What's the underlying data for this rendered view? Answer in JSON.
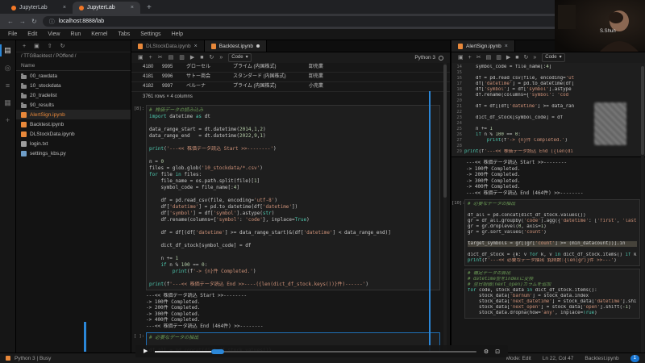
{
  "browser": {
    "tabs": [
      {
        "title": "JupyterLab"
      },
      {
        "title": "JupyterLab"
      }
    ],
    "url": "localhost:8888/lab",
    "nav_icons": [
      {
        "name": "back-icon",
        "glyph": "←"
      },
      {
        "name": "forward-icon",
        "glyph": "→"
      },
      {
        "name": "reload-icon",
        "glyph": "↻"
      }
    ],
    "site_info_glyph": "ⓘ",
    "bookmark_glyph": "☆",
    "overflow_glyph": "⋮"
  },
  "shared": {
    "close_glyph": "×",
    "caret_glyph": "▾",
    "cell_type": "Code",
    "load_output": [
      "---<< 株価データ読込 Start >>--------",
      "-> 100件 Completed.",
      "-> 200件 Completed.",
      "-> 300件 Completed.",
      "-> 400件 Completed.",
      "---<< 株価データ読込 End (464件) >>--------"
    ],
    "notebook_toolbar_icons": [
      {
        "name": "save-icon",
        "glyph": "▣"
      },
      {
        "name": "add-cell-icon",
        "glyph": "+"
      },
      {
        "name": "cut-cell-icon",
        "glyph": "✂"
      },
      {
        "name": "copy-cell-icon",
        "glyph": "▤"
      },
      {
        "name": "paste-cell-icon",
        "glyph": "▥"
      },
      {
        "name": "run-cell-icon",
        "glyph": "▶"
      },
      {
        "name": "stop-kernel-icon",
        "glyph": "■"
      },
      {
        "name": "restart-kernel-icon",
        "glyph": "↻"
      },
      {
        "name": "restart-run-all-icon",
        "glyph": "»"
      }
    ]
  },
  "webcam": {
    "label": "S.Shun"
  },
  "menubar": {
    "items": [
      "File",
      "Edit",
      "View",
      "Run",
      "Kernel",
      "Tabs",
      "Settings",
      "Help"
    ]
  },
  "activitybar": {
    "icons": [
      {
        "name": "file-browser-icon",
        "glyph": "▤",
        "cls": "active"
      },
      {
        "name": "running-sessions-icon",
        "glyph": "◎"
      },
      {
        "name": "command-palette-icon",
        "glyph": "≡"
      },
      {
        "name": "property-inspector-icon",
        "glyph": "▦"
      },
      {
        "name": "extensions-icon",
        "glyph": "+"
      }
    ]
  },
  "filebrowser": {
    "action_icons": [
      {
        "name": "new-launcher-icon",
        "glyph": "+"
      },
      {
        "name": "new-folder-icon",
        "glyph": "▣"
      },
      {
        "name": "upload-icon",
        "glyph": "⇧"
      },
      {
        "name": "refresh-icon",
        "glyph": "↻"
      }
    ],
    "breadcrumb": "/ TTGBacktest / POffend /",
    "header": "Name",
    "items": [
      {
        "name": "folder-00-rawdata",
        "label": "00_rawdata",
        "icon_cls": "ic-folder"
      },
      {
        "name": "folder-10-stockdata",
        "label": "10_stockdata",
        "icon_cls": "ic-folder"
      },
      {
        "name": "folder-20-tradelist",
        "label": "20_tradelist",
        "icon_cls": "ic-folder"
      },
      {
        "name": "folder-90-results",
        "label": "90_results",
        "icon_cls": "ic-folder"
      },
      {
        "name": "file-alertsign-ipynb",
        "label": "AlertSign.ipynb",
        "icon_cls": "ic-nb",
        "row_cls": "accent"
      },
      {
        "name": "file-backtest-ipynb",
        "label": "Backtest.ipynb",
        "icon_cls": "ic-nb"
      },
      {
        "name": "file-dlstockdata-ipynb",
        "label": "DLStockData.ipynb",
        "icon_cls": "ic-nb"
      },
      {
        "name": "file-login-txt",
        "label": "login.txt",
        "icon_cls": "ic-txt"
      },
      {
        "name": "file-settings-kbs-py",
        "label": "settings_kbs.py",
        "icon_cls": "ic-py"
      }
    ]
  },
  "center": {
    "tabs": [
      {
        "label": "DLStockData.ipynb"
      },
      {
        "label": "Backtest.ipynb"
      }
    ],
    "kernel_label": "Python 3",
    "table": {
      "rows": [
        [
          "4180",
          "9995",
          "グローセル",
          "プライム (内国株式)",
          "卸売業"
        ],
        [
          "4181",
          "9996",
          "サトー商会",
          "スタンダード (内国株式)",
          "卸売業"
        ],
        [
          "4182",
          "9997",
          "ベルーナ",
          "プライム (内国株式)",
          "小売業"
        ]
      ],
      "summary": "3761 rows × 4 columns"
    },
    "cell8": {
      "prompt": "[8]:",
      "code": [
        [
          [
            "cm",
            "# 株価データの読み込み"
          ]
        ],
        [
          [
            "kw",
            "import"
          ],
          [
            "df",
            " datetime "
          ],
          [
            "kw",
            "as"
          ],
          [
            "df",
            " dt"
          ]
        ],
        [],
        [
          [
            "df",
            "data_range_start = dt.datetime("
          ],
          [
            "nu",
            "2014"
          ],
          [
            "df",
            ","
          ],
          [
            "nu",
            "1"
          ],
          [
            "df",
            ","
          ],
          [
            "nu",
            "2"
          ],
          [
            "df",
            ")"
          ]
        ],
        [
          [
            "df",
            "data_range_end   = dt.datetime("
          ],
          [
            "nu",
            "2022"
          ],
          [
            "df",
            ","
          ],
          [
            "nu",
            "9"
          ],
          [
            "df",
            ","
          ],
          [
            "nu",
            "1"
          ],
          [
            "df",
            ")"
          ]
        ],
        [],
        [
          [
            "kw",
            "print"
          ],
          [
            "df",
            "("
          ],
          [
            "st",
            "'---<< 株価データ読込 Start >>--------'"
          ],
          [
            "df",
            ")"
          ]
        ],
        [],
        [
          [
            "df",
            "n = "
          ],
          [
            "nu",
            "0"
          ]
        ],
        [
          [
            "df",
            "files = glob.glob("
          ],
          [
            "st",
            "'10_stockdata/*.csv'"
          ],
          [
            "df",
            ")"
          ]
        ],
        [
          [
            "kw",
            "for"
          ],
          [
            "df",
            " file "
          ],
          [
            "kw",
            "in"
          ],
          [
            "df",
            " files:"
          ]
        ],
        [
          [
            "df",
            "    file_name = os.path.split(file)["
          ],
          [
            "nu",
            "1"
          ],
          [
            "df",
            "]"
          ]
        ],
        [
          [
            "df",
            "    symbol_code = file_name[:"
          ],
          [
            "nu",
            "4"
          ],
          [
            "df",
            "]"
          ]
        ],
        [],
        [
          [
            "df",
            "    df = pd.read_csv(file, encoding="
          ],
          [
            "st",
            "'utf-8'"
          ],
          [
            "df",
            ")"
          ]
        ],
        [
          [
            "df",
            "    df["
          ],
          [
            "st",
            "'datetime'"
          ],
          [
            "df",
            "] = pd.to_datetime(df["
          ],
          [
            "st",
            "'datetime'"
          ],
          [
            "df",
            "])"
          ]
        ],
        [
          [
            "df",
            "    df["
          ],
          [
            "st",
            "'symbol'"
          ],
          [
            "df",
            "] = df["
          ],
          [
            "st",
            "'symbol'"
          ],
          [
            "df",
            "].astype("
          ],
          [
            "kw",
            "str"
          ],
          [
            "df",
            ")"
          ]
        ],
        [
          [
            "df",
            "    df.rename(columns={"
          ],
          [
            "st",
            "'symbol'"
          ],
          [
            "df",
            ": "
          ],
          [
            "st",
            "'code'"
          ],
          [
            "df",
            "}, inplace="
          ],
          [
            "kw",
            "True"
          ],
          [
            "df",
            ")"
          ]
        ],
        [],
        [
          [
            "df",
            "    df = df[(df["
          ],
          [
            "st",
            "'datetime'"
          ],
          [
            "df",
            "] >= data_range_start)&(df["
          ],
          [
            "st",
            "'datetime'"
          ],
          [
            "df",
            "] < data_range_end)]"
          ]
        ],
        [],
        [
          [
            "df",
            "    dict_df_stock[symbol_code] = df"
          ]
        ],
        [],
        [
          [
            "df",
            "    n += "
          ],
          [
            "nu",
            "1"
          ]
        ],
        [
          [
            "kw",
            "    if"
          ],
          [
            "df",
            " n % "
          ],
          [
            "nu",
            "100"
          ],
          [
            "df",
            " == "
          ],
          [
            "nu",
            "0"
          ],
          [
            "df",
            ":"
          ]
        ],
        [
          [
            "df",
            "        "
          ],
          [
            "kw",
            "print"
          ],
          [
            "df",
            "(f"
          ],
          [
            "st",
            "'-> {n}件 Completed.'"
          ],
          [
            "df",
            ")"
          ]
        ],
        [],
        [
          [
            "kw",
            "print"
          ],
          [
            "df",
            "(f"
          ],
          [
            "st",
            "'---<< 株価データ読込 End >>----({len(dict_df_stock.keys())}件)------'"
          ],
          [
            "df",
            ")"
          ]
        ]
      ]
    },
    "cell_next": {
      "prompt": "[ ]:",
      "code": [
        [
          [
            "cm",
            "# 必要なデータの抽出"
          ]
        ],
        [],
        [
          [
            "df",
            "df_all = pd.concat(dict_df_stock.values())"
          ]
        ]
      ]
    }
  },
  "right": {
    "tab": {
      "label": "AlertSign.ipynb"
    },
    "editor": {
      "line_numbers": [
        "14",
        "15",
        "16",
        "17",
        "18",
        "19",
        "20",
        "21",
        "22",
        "23",
        "24",
        "25",
        "26",
        "27",
        "28",
        "29"
      ],
      "code": [
        [
          [
            "df",
            "    symbol_code = file_name[:"
          ],
          [
            "nu",
            "4"
          ],
          [
            "df",
            "]"
          ]
        ],
        [],
        [
          [
            "df",
            "    df = pd.read_csv(file, encoding="
          ],
          [
            "st",
            "'ut"
          ]
        ],
        [
          [
            "df",
            "    df["
          ],
          [
            "st",
            "'datetime'"
          ],
          [
            "df",
            "] = pd.to_datetime(df["
          ]
        ],
        [
          [
            "df",
            "    df["
          ],
          [
            "st",
            "'symbol'"
          ],
          [
            "df",
            "] = df["
          ],
          [
            "st",
            "'symbol'"
          ],
          [
            "df",
            "].astype"
          ]
        ],
        [
          [
            "df",
            "    df.rename(columns={"
          ],
          [
            "st",
            "'symbol'"
          ],
          [
            "df",
            ": "
          ],
          [
            "st",
            "'cod"
          ]
        ],
        [],
        [
          [
            "df",
            "    df = df[(df["
          ],
          [
            "st",
            "'datetime'"
          ],
          [
            "df",
            "] >= data_ran"
          ]
        ],
        [],
        [
          [
            "df",
            "    dict_df_stock[symbol_code] = df"
          ]
        ],
        [],
        [
          [
            "df",
            "    n += "
          ],
          [
            "nu",
            "1"
          ]
        ],
        [
          [
            "kw",
            "    if"
          ],
          [
            "df",
            " n % "
          ],
          [
            "nu",
            "100"
          ],
          [
            "df",
            " == "
          ],
          [
            "nu",
            "0"
          ],
          [
            "df",
            ":"
          ]
        ],
        [
          [
            "df",
            "        "
          ],
          [
            "kw",
            "print"
          ],
          [
            "df",
            "(f"
          ],
          [
            "st",
            "'-> {n}件 Completed.'"
          ],
          [
            "df",
            ")"
          ]
        ],
        [],
        [
          [
            "kw",
            "print"
          ],
          [
            "df",
            "(f"
          ],
          [
            "st",
            "'---<< 株価データ読込 End ({len(di"
          ]
        ]
      ]
    },
    "cell10": {
      "prompt": "[10]:",
      "code": [
        [
          [
            "cm",
            "# 必要なデータの抽出"
          ]
        ],
        [],
        [
          [
            "df",
            "df_all = pd.concat(dict_df_stock.values())"
          ]
        ],
        [
          [
            "df",
            "gr = df_all.groupby("
          ],
          [
            "st",
            "'code'"
          ],
          [
            "df",
            ").agg({"
          ],
          [
            "st",
            "'datetime'"
          ],
          [
            "df",
            ": ["
          ],
          [
            "st",
            "'first'"
          ],
          [
            "df",
            ", "
          ],
          [
            "st",
            "'last'"
          ]
        ],
        [
          [
            "df",
            "gr = gr.droplevel("
          ],
          [
            "nu",
            "0"
          ],
          [
            "df",
            ", axis="
          ],
          [
            "nu",
            "1"
          ],
          [
            "df",
            ")"
          ]
        ],
        [
          [
            "df",
            "gr = gr.sort_values("
          ],
          [
            "st",
            "'count'"
          ],
          [
            "df",
            ")"
          ]
        ],
        [],
        {
          "h": 1,
          "t": [
            [
              "df",
              "target_symbols = gr[(gr["
            ],
            [
              "st",
              "'count'"
            ],
            [
              "df",
              "] >= (min_datacount))].in"
            ]
          ]
        },
        [],
        [
          [
            "df",
            "dict_df_stock = {k: v "
          ],
          [
            "kw",
            "for"
          ],
          [
            "df",
            " k, v "
          ],
          [
            "kw",
            "in"
          ],
          [
            "df",
            " dict_df_stock.items() "
          ],
          [
            "kw",
            "if"
          ],
          [
            "df",
            " k i"
          ]
        ],
        [
          [
            "kw",
            "print"
          ],
          [
            "df",
            "(f"
          ],
          [
            "st",
            "'---<< 必要なデータ抽出 銘柄数:{len(gr)}件 >>---'"
          ],
          [
            "df",
            ")"
          ]
        ]
      ]
    },
    "cell_bottom": {
      "code": [
        [
          [
            "cm",
            "# 補足データの算出"
          ]
        ],
        [
          [
            "cm",
            "# datetime型をindexに変換"
          ]
        ],
        [
          [
            "cm",
            "# 翌日始値(next_open)カラムを追加"
          ]
        ],
        [
          [
            "kw",
            "for"
          ],
          [
            "df",
            " code, stock_data "
          ],
          [
            "kw",
            "in"
          ],
          [
            "df",
            " dict_df_stock.items():"
          ]
        ],
        [
          [
            "df",
            "    stock_data["
          ],
          [
            "st",
            "'barnum'"
          ],
          [
            "df",
            "] = stock_data.index"
          ]
        ],
        [
          [
            "df",
            "    stock_data["
          ],
          [
            "st",
            "'next_datetime'"
          ],
          [
            "df",
            "] = stock_data["
          ],
          [
            "st",
            "'datetime'"
          ],
          [
            "df",
            "].shift"
          ]
        ],
        [
          [
            "df",
            "    stock_data["
          ],
          [
            "st",
            "'next_open'"
          ],
          [
            "df",
            "] = stock_data["
          ],
          [
            "st",
            "'open'"
          ],
          [
            "df",
            "].shift("
          ],
          [
            "nu",
            "-1"
          ],
          [
            "df",
            ")"
          ]
        ],
        [
          [
            "df",
            "    stock_data.dropna(how="
          ],
          [
            "st",
            "'any'"
          ],
          [
            "df",
            ", inplace="
          ],
          [
            "kw",
            "True"
          ],
          [
            "df",
            ")"
          ]
        ]
      ]
    }
  },
  "statusbar": {
    "kernel_status": "Python 3 | Busy",
    "mode": "Mode: Edit",
    "position": "Ln 22, Col 47",
    "filename": "Backtest.ipynb",
    "badge": "1"
  },
  "player": {
    "icons": [
      {
        "name": "play-icon",
        "glyph": "▶"
      }
    ],
    "right_icons": [
      {
        "name": "settings-icon",
        "glyph": "⚙"
      },
      {
        "name": "fullscreen-icon",
        "glyph": "⊡"
      }
    ]
  },
  "colors": {
    "accent_blue": "#2b87d8",
    "jupyter_orange": "#f37726",
    "file_accent": "#e8883a"
  }
}
